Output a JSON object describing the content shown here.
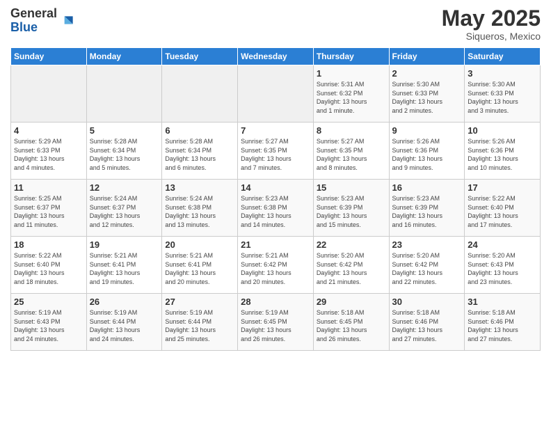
{
  "logo": {
    "general": "General",
    "blue": "Blue"
  },
  "header": {
    "month": "May 2025",
    "location": "Siqueros, Mexico"
  },
  "weekdays": [
    "Sunday",
    "Monday",
    "Tuesday",
    "Wednesday",
    "Thursday",
    "Friday",
    "Saturday"
  ],
  "weeks": [
    [
      {
        "day": "",
        "info": ""
      },
      {
        "day": "",
        "info": ""
      },
      {
        "day": "",
        "info": ""
      },
      {
        "day": "",
        "info": ""
      },
      {
        "day": "1",
        "info": "Sunrise: 5:31 AM\nSunset: 6:32 PM\nDaylight: 13 hours\nand 1 minute."
      },
      {
        "day": "2",
        "info": "Sunrise: 5:30 AM\nSunset: 6:33 PM\nDaylight: 13 hours\nand 2 minutes."
      },
      {
        "day": "3",
        "info": "Sunrise: 5:30 AM\nSunset: 6:33 PM\nDaylight: 13 hours\nand 3 minutes."
      }
    ],
    [
      {
        "day": "4",
        "info": "Sunrise: 5:29 AM\nSunset: 6:33 PM\nDaylight: 13 hours\nand 4 minutes."
      },
      {
        "day": "5",
        "info": "Sunrise: 5:28 AM\nSunset: 6:34 PM\nDaylight: 13 hours\nand 5 minutes."
      },
      {
        "day": "6",
        "info": "Sunrise: 5:28 AM\nSunset: 6:34 PM\nDaylight: 13 hours\nand 6 minutes."
      },
      {
        "day": "7",
        "info": "Sunrise: 5:27 AM\nSunset: 6:35 PM\nDaylight: 13 hours\nand 7 minutes."
      },
      {
        "day": "8",
        "info": "Sunrise: 5:27 AM\nSunset: 6:35 PM\nDaylight: 13 hours\nand 8 minutes."
      },
      {
        "day": "9",
        "info": "Sunrise: 5:26 AM\nSunset: 6:36 PM\nDaylight: 13 hours\nand 9 minutes."
      },
      {
        "day": "10",
        "info": "Sunrise: 5:26 AM\nSunset: 6:36 PM\nDaylight: 13 hours\nand 10 minutes."
      }
    ],
    [
      {
        "day": "11",
        "info": "Sunrise: 5:25 AM\nSunset: 6:37 PM\nDaylight: 13 hours\nand 11 minutes."
      },
      {
        "day": "12",
        "info": "Sunrise: 5:24 AM\nSunset: 6:37 PM\nDaylight: 13 hours\nand 12 minutes."
      },
      {
        "day": "13",
        "info": "Sunrise: 5:24 AM\nSunset: 6:38 PM\nDaylight: 13 hours\nand 13 minutes."
      },
      {
        "day": "14",
        "info": "Sunrise: 5:23 AM\nSunset: 6:38 PM\nDaylight: 13 hours\nand 14 minutes."
      },
      {
        "day": "15",
        "info": "Sunrise: 5:23 AM\nSunset: 6:39 PM\nDaylight: 13 hours\nand 15 minutes."
      },
      {
        "day": "16",
        "info": "Sunrise: 5:23 AM\nSunset: 6:39 PM\nDaylight: 13 hours\nand 16 minutes."
      },
      {
        "day": "17",
        "info": "Sunrise: 5:22 AM\nSunset: 6:40 PM\nDaylight: 13 hours\nand 17 minutes."
      }
    ],
    [
      {
        "day": "18",
        "info": "Sunrise: 5:22 AM\nSunset: 6:40 PM\nDaylight: 13 hours\nand 18 minutes."
      },
      {
        "day": "19",
        "info": "Sunrise: 5:21 AM\nSunset: 6:41 PM\nDaylight: 13 hours\nand 19 minutes."
      },
      {
        "day": "20",
        "info": "Sunrise: 5:21 AM\nSunset: 6:41 PM\nDaylight: 13 hours\nand 20 minutes."
      },
      {
        "day": "21",
        "info": "Sunrise: 5:21 AM\nSunset: 6:42 PM\nDaylight: 13 hours\nand 20 minutes."
      },
      {
        "day": "22",
        "info": "Sunrise: 5:20 AM\nSunset: 6:42 PM\nDaylight: 13 hours\nand 21 minutes."
      },
      {
        "day": "23",
        "info": "Sunrise: 5:20 AM\nSunset: 6:42 PM\nDaylight: 13 hours\nand 22 minutes."
      },
      {
        "day": "24",
        "info": "Sunrise: 5:20 AM\nSunset: 6:43 PM\nDaylight: 13 hours\nand 23 minutes."
      }
    ],
    [
      {
        "day": "25",
        "info": "Sunrise: 5:19 AM\nSunset: 6:43 PM\nDaylight: 13 hours\nand 24 minutes."
      },
      {
        "day": "26",
        "info": "Sunrise: 5:19 AM\nSunset: 6:44 PM\nDaylight: 13 hours\nand 24 minutes."
      },
      {
        "day": "27",
        "info": "Sunrise: 5:19 AM\nSunset: 6:44 PM\nDaylight: 13 hours\nand 25 minutes."
      },
      {
        "day": "28",
        "info": "Sunrise: 5:19 AM\nSunset: 6:45 PM\nDaylight: 13 hours\nand 26 minutes."
      },
      {
        "day": "29",
        "info": "Sunrise: 5:18 AM\nSunset: 6:45 PM\nDaylight: 13 hours\nand 26 minutes."
      },
      {
        "day": "30",
        "info": "Sunrise: 5:18 AM\nSunset: 6:46 PM\nDaylight: 13 hours\nand 27 minutes."
      },
      {
        "day": "31",
        "info": "Sunrise: 5:18 AM\nSunset: 6:46 PM\nDaylight: 13 hours\nand 27 minutes."
      }
    ]
  ]
}
